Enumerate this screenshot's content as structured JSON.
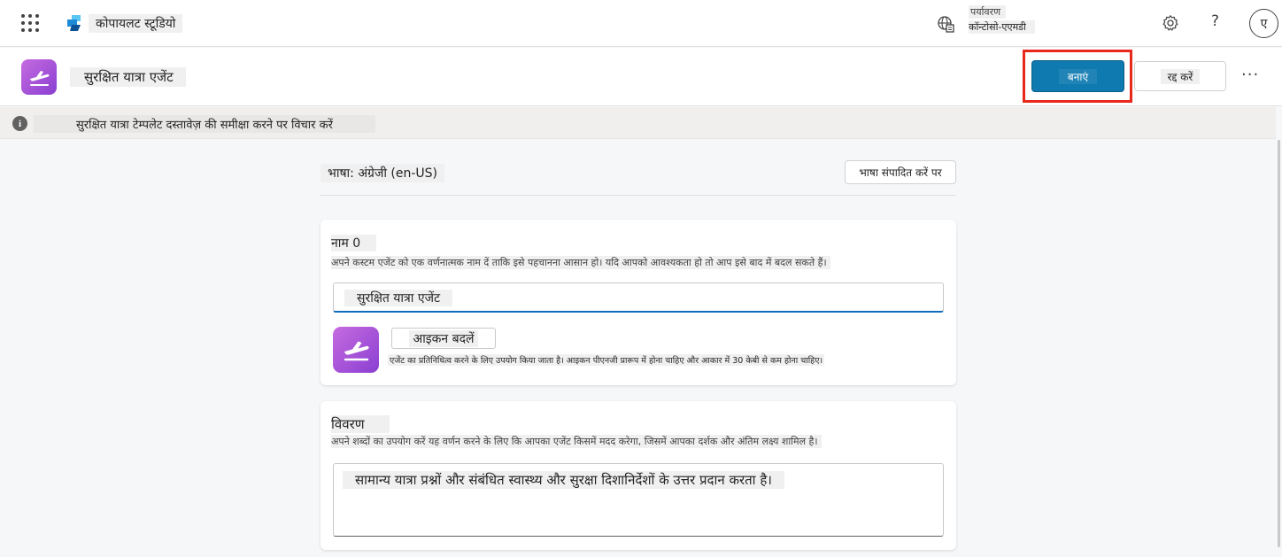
{
  "app": {
    "name": "कोपायलट स्टूडियो"
  },
  "environment": {
    "label": "पर्यावरण",
    "value": "कॉन्टोसो-एएमडी"
  },
  "user": {
    "avatar_initial": "ए"
  },
  "header": {
    "help_glyph": "?"
  },
  "agent": {
    "title": "सुरक्षित यात्रा एजेंट",
    "create_label": "बनाएं",
    "cancel_label": "रद्द करें",
    "more_glyph": "···"
  },
  "banner": {
    "text": "सुरक्षित यात्रा टेम्पलेट दस्तावेज़ की समीक्षा करने पर विचार करें"
  },
  "language": {
    "label": "भाषा: अंग्रेजी (en-US)",
    "edit_label": "भाषा संपादित करें पर"
  },
  "name_section": {
    "label": "नाम 0",
    "help": "अपने कस्टम एजेंट को एक वर्णनात्मक नाम दें ताकि इसे पहचानना आसान हो। यदि आपको आवश्यकता हो तो आप इसे बाद में बदल सकते हैं।",
    "value": "सुरक्षित यात्रा एजेंट",
    "change_icon_label": "आइकन बदलें",
    "icon_help": "एजेंट का प्रतिनिधित्व करने के लिए उपयोग किया जाता है। आइकन पीएनजी प्रारूप में होना चाहिए और आकार में 30 केबी से कम होना चाहिए।"
  },
  "description_section": {
    "label": "विवरण",
    "help": "अपने शब्दों का उपयोग करें यह वर्णन करने के लिए कि आपका एजेंट किसमें मदद करेगा, जिसमें आपका दर्शक और अंतिम लक्ष्य शामिल है।",
    "value": "सामान्य यात्रा प्रश्नों और संबंधित स्वास्थ्य और सुरक्षा दिशानिर्देशों के उत्तर प्रदान करता है।"
  },
  "icons": {
    "waffle": "app-launcher-icon",
    "logo": "copilot-studio-logo",
    "environment": "globe-building-icon",
    "settings": "gear-icon",
    "help": "help-icon",
    "info": "info-icon",
    "agent": "airplane-departure-icon"
  },
  "colors": {
    "primary_button": "#0f7ab0",
    "highlight_box": "#e8281b",
    "agent_icon_gradient_start": "#c66be0",
    "agent_icon_gradient_end": "#8a3fd1",
    "input_focus_underline": "#0f6cbd"
  }
}
